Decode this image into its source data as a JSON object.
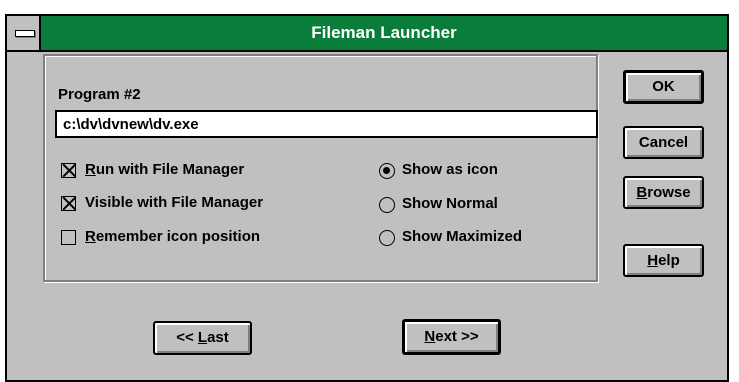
{
  "window": {
    "title": "Fileman Launcher"
  },
  "program": {
    "label": "Program #2",
    "path": "c:\\dv\\dvnew\\dv.exe"
  },
  "checkboxes": [
    {
      "pre": "",
      "key": "R",
      "rest": "un with File Manager",
      "checked": true
    },
    {
      "pre": "Visible with File Manager",
      "key": "",
      "rest": "",
      "checked": true
    },
    {
      "pre": "",
      "key": "R",
      "rest": "emember icon position",
      "checked": false
    }
  ],
  "radios": [
    {
      "label": "Show as icon",
      "selected": true
    },
    {
      "label": "Show Normal",
      "selected": false
    },
    {
      "label": "Show Maximized",
      "selected": false
    }
  ],
  "buttons": {
    "ok": "OK",
    "cancel": "Cancel",
    "browse": {
      "key": "B",
      "rest": "rowse"
    },
    "help": {
      "key": "H",
      "rest": "elp"
    },
    "last": {
      "pre": "<< ",
      "key": "L",
      "rest": "ast"
    },
    "next": {
      "pre": "",
      "key": "N",
      "rest": "ext >>"
    }
  },
  "colors": {
    "titlebar": "#0a7d3a",
    "face": "#c0c0c0"
  }
}
